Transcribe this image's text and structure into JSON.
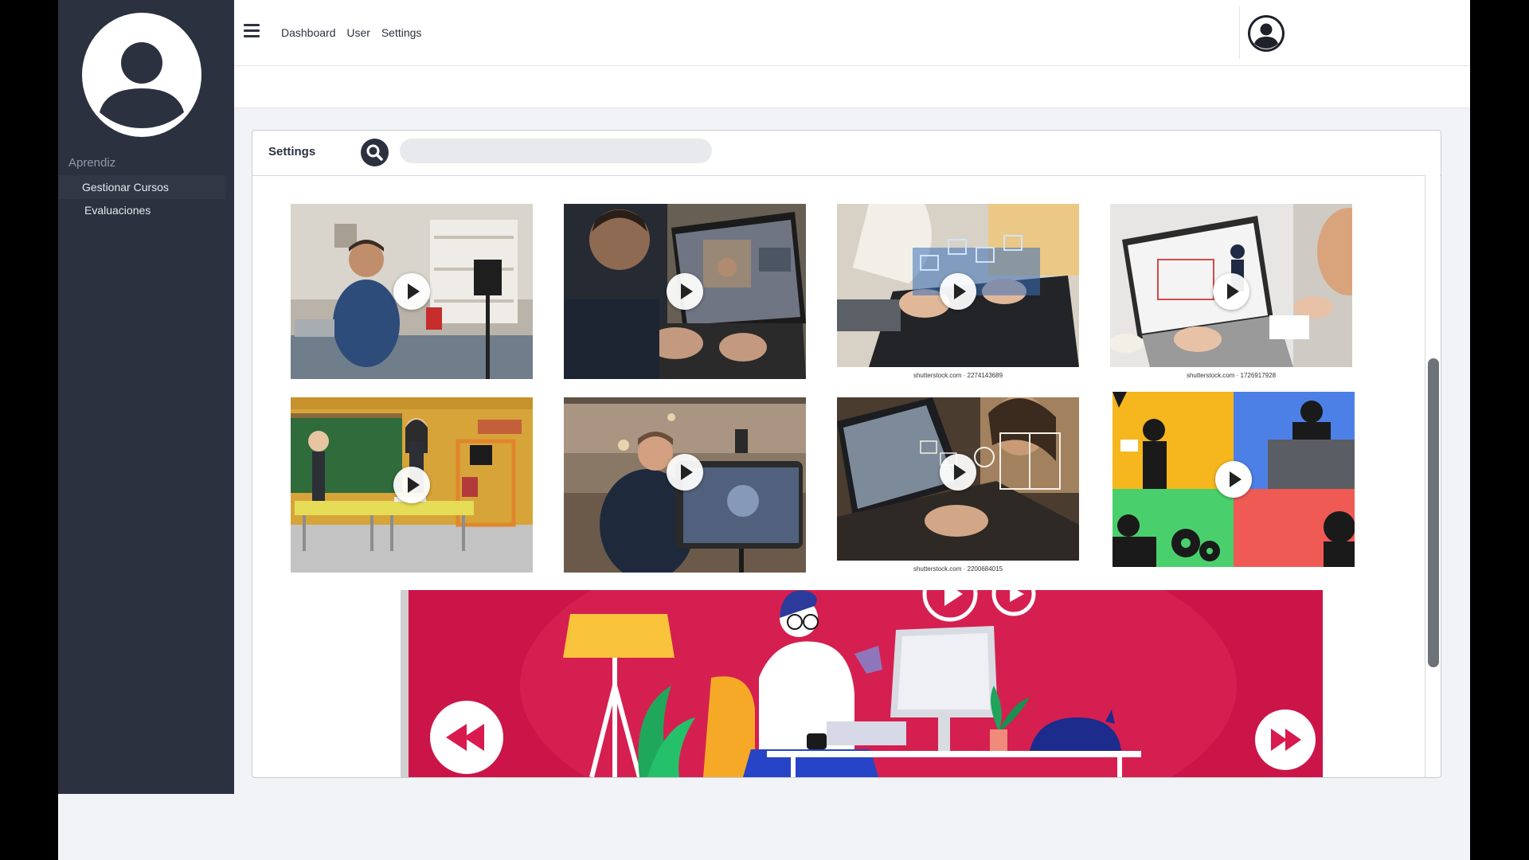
{
  "sidebar": {
    "section_label": "Aprendiz",
    "items": [
      {
        "label": "Gestionar Cursos"
      },
      {
        "label": "Evaluaciones"
      }
    ]
  },
  "topbar": {
    "nav": [
      {
        "label": "Dashboard"
      },
      {
        "label": "User"
      },
      {
        "label": "Settings"
      }
    ]
  },
  "card": {
    "title": "Settings",
    "search_placeholder": ""
  },
  "videos": [
    {
      "caption": "",
      "scene": "man recording vlog with camera"
    },
    {
      "caption": "",
      "scene": "video call on laptop"
    },
    {
      "caption": "shutterstock.com · 2274143689",
      "scene": "e-learning icons over laptop"
    },
    {
      "caption": "shutterstock.com · 1726917928",
      "scene": "online lesson on laptop"
    },
    {
      "caption": "",
      "scene": "animated classroom"
    },
    {
      "caption": "",
      "scene": "man recording video"
    },
    {
      "caption": "shutterstock.com · 2200684015",
      "scene": "woman studying with laptop"
    },
    {
      "caption": "",
      "scene": "animated remote workers"
    }
  ],
  "banner": {
    "scene": "animated woman working at desk",
    "colors": {
      "background": "#d81a4e",
      "nav_button": "#ffffff",
      "nav_icon": "#d81a4e"
    }
  },
  "icons": [
    "user-avatar-icon",
    "hamburger-icon",
    "search-icon",
    "play-icon",
    "rewind-icon",
    "fast-forward-icon"
  ]
}
